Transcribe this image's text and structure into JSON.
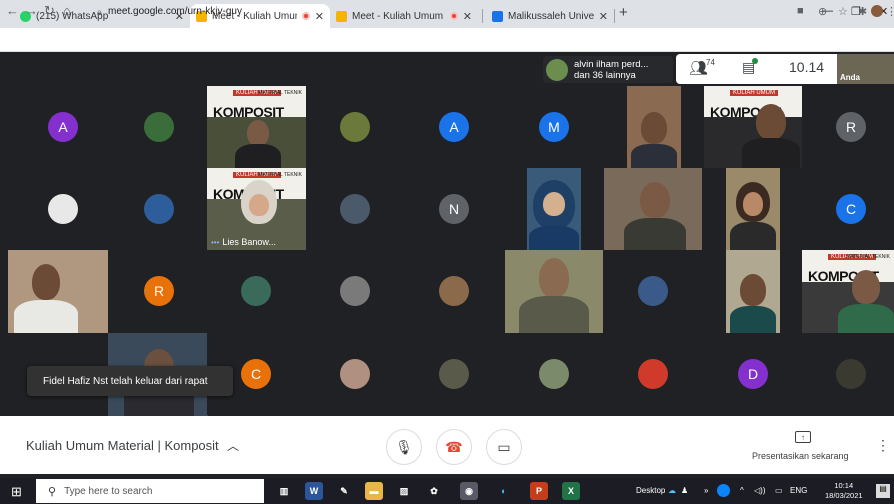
{
  "browser": {
    "tabs": [
      {
        "title": "(215) WhatsApp",
        "favicon_color": "#25d366",
        "recording": false
      },
      {
        "title": "Meet - Kuliah Umum Materi",
        "favicon_color": "#f4b400",
        "recording": true
      },
      {
        "title": "Meet - Kuliah Umum Materi",
        "favicon_color": "#f4b400",
        "recording": true
      },
      {
        "title": "Malikussaleh University - Calend",
        "favicon_color": "#1a73e8",
        "recording": false
      }
    ],
    "new_tab": "+",
    "url": "meet.google.com/urn-kkjv-guy"
  },
  "meet": {
    "participant_info": {
      "name": "alvin ilham perd...",
      "others": "dan 36 lainnya"
    },
    "people_count": "74",
    "clock": "10.14",
    "self_label": "Anda",
    "notification": "Fidel Hafiz Nst telah keluar dari rapat",
    "meeting_title": "Kuliah Umum Material | Komposit",
    "present_label": "Presentasikan sekarang",
    "named_tile": "Lies Banow...",
    "banner_title": "KOMPOSIT",
    "banner_small": "KULIAH UMUM",
    "banner_right": "MATERIAL TEKNIK",
    "initials": {
      "a1": "A",
      "a2": "A",
      "m": "M",
      "r1": "R",
      "n": "N",
      "c1": "C",
      "r2": "R",
      "c2": "C",
      "d": "D"
    },
    "colors": {
      "purple": "#8430ce",
      "blue": "#1a73e8",
      "gray": "#5f6368",
      "orange": "#e8710a",
      "cyan": "#1a73e8",
      "red_btn": "#ea4335"
    }
  },
  "taskbar": {
    "search_placeholder": "Type here to search",
    "desktop_label": "Desktop",
    "lang": "ENG",
    "time": "10:14",
    "date": "18/03/2021"
  }
}
